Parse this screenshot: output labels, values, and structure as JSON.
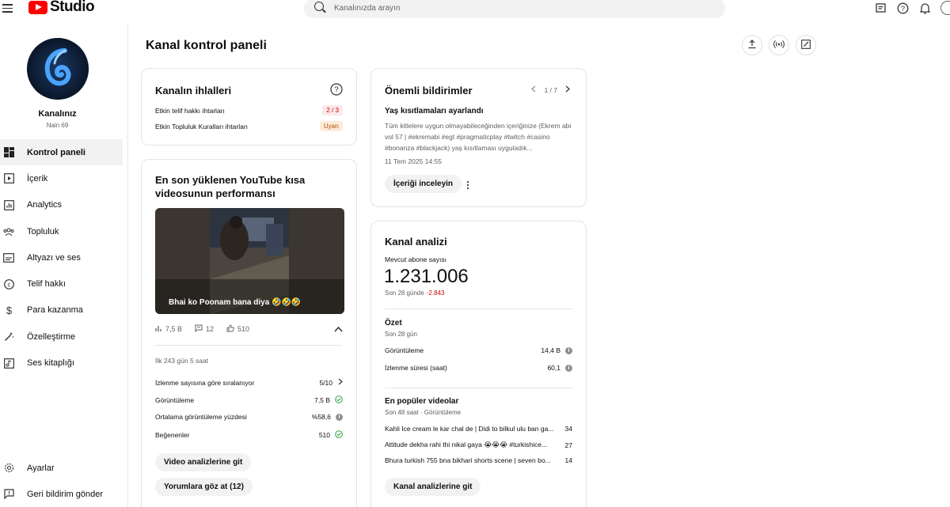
{
  "app": {
    "logo_text": "Studio"
  },
  "search": {
    "placeholder": "Kanalınızda arayın"
  },
  "channel": {
    "name": "Kanalınız",
    "subtitle": "Nain 69"
  },
  "sidebar": {
    "items": [
      {
        "label": "Kontrol paneli",
        "icon": "dashboard-icon",
        "active": true
      },
      {
        "label": "İçerik",
        "icon": "content-icon"
      },
      {
        "label": "Analytics",
        "icon": "analytics-icon"
      },
      {
        "label": "Topluluk",
        "icon": "community-icon"
      },
      {
        "label": "Altyazı ve ses",
        "icon": "subtitles-icon"
      },
      {
        "label": "Telif hakkı",
        "icon": "copyright-icon"
      },
      {
        "label": "Para kazanma",
        "icon": "monetization-icon"
      },
      {
        "label": "Özelleştirme",
        "icon": "customization-icon"
      },
      {
        "label": "Ses kitaplığı",
        "icon": "audio-library-icon"
      }
    ],
    "bottom": [
      {
        "label": "Ayarlar",
        "icon": "settings-icon"
      },
      {
        "label": "Geri bildirim gönder",
        "icon": "feedback-icon"
      }
    ]
  },
  "page": {
    "title": "Kanal kontrol paneli"
  },
  "violations": {
    "title": "Kanalın ihlalleri",
    "rows": [
      {
        "label": "Etkin telif hakkı ihtarları",
        "value": "2 / 3"
      },
      {
        "label": "Etkin Topluluk Kuralları ihtarları",
        "value": "Uyarı"
      }
    ]
  },
  "latest_short": {
    "title": "En son yüklenen YouTube kısa videosunun performansı",
    "caption": "Bhai ko Poonam bana diya 🤣🤣🤣",
    "stats": {
      "views": "7,5 B",
      "comments": "12",
      "likes": "510"
    },
    "period": "İlk 243 gün 5 saat",
    "rows": [
      {
        "label": "İzlenme sayısına göre sıralanıyor",
        "value": "5/10"
      },
      {
        "label": "Görüntüleme",
        "value": "7,5 B"
      },
      {
        "label": "Ortalama görüntüleme yüzdesi",
        "value": "%58,6"
      },
      {
        "label": "Beğenenler",
        "value": "510"
      }
    ],
    "btn_analytics": "Video analizlerine git",
    "btn_comments": "Yorumlara göz at (12)"
  },
  "notifications": {
    "title": "Önemli bildirimler",
    "pager": "1 / 7",
    "headline": "Yaş kısıtlamaları ayarlandı",
    "body": "Tüm kitlelere uygun olmayabileceğinden içeriğinize (Ekrem abi vol 57 | #ekremabi #egt #pragmaticplay #twitch #casino #bonanza #blackjack) yaş kısıtlaması uyguladık...",
    "date": "11 Tem 2025 14:55",
    "button": "İçeriği inceleyin"
  },
  "analytics": {
    "title": "Kanal analizi",
    "subs_label": "Mevcut abone sayısı",
    "subs_value": "1.231.006",
    "subs_change_label": "Son 28 günde",
    "subs_change_value": "-2.843",
    "summary_title": "Özet",
    "summary_period": "Son 28 gün",
    "summary_rows": [
      {
        "label": "Görüntüleme",
        "value": "14,4 B"
      },
      {
        "label": "İzlenme süresi (saat)",
        "value": "60,1"
      }
    ],
    "top_title": "En popüler videolar",
    "top_period": "Son 48 saat · Görüntüleme",
    "top_videos": [
      {
        "title": "Kahli Ice cream le kar chal de | Didi to bilkul ulu ban ga...",
        "views": "34"
      },
      {
        "title": "Attitude dekha rahi thi nikal gaya 😭😭😭 #turkishice...",
        "views": "27"
      },
      {
        "title": "Bhura turkish 755 bna bikhari shorts scene | seven bo...",
        "views": "14"
      }
    ],
    "button": "Kanal analizlerine git"
  },
  "colors": {
    "brand": "#ff0000",
    "negative": "#cc0000",
    "positive": "#2ba640"
  }
}
